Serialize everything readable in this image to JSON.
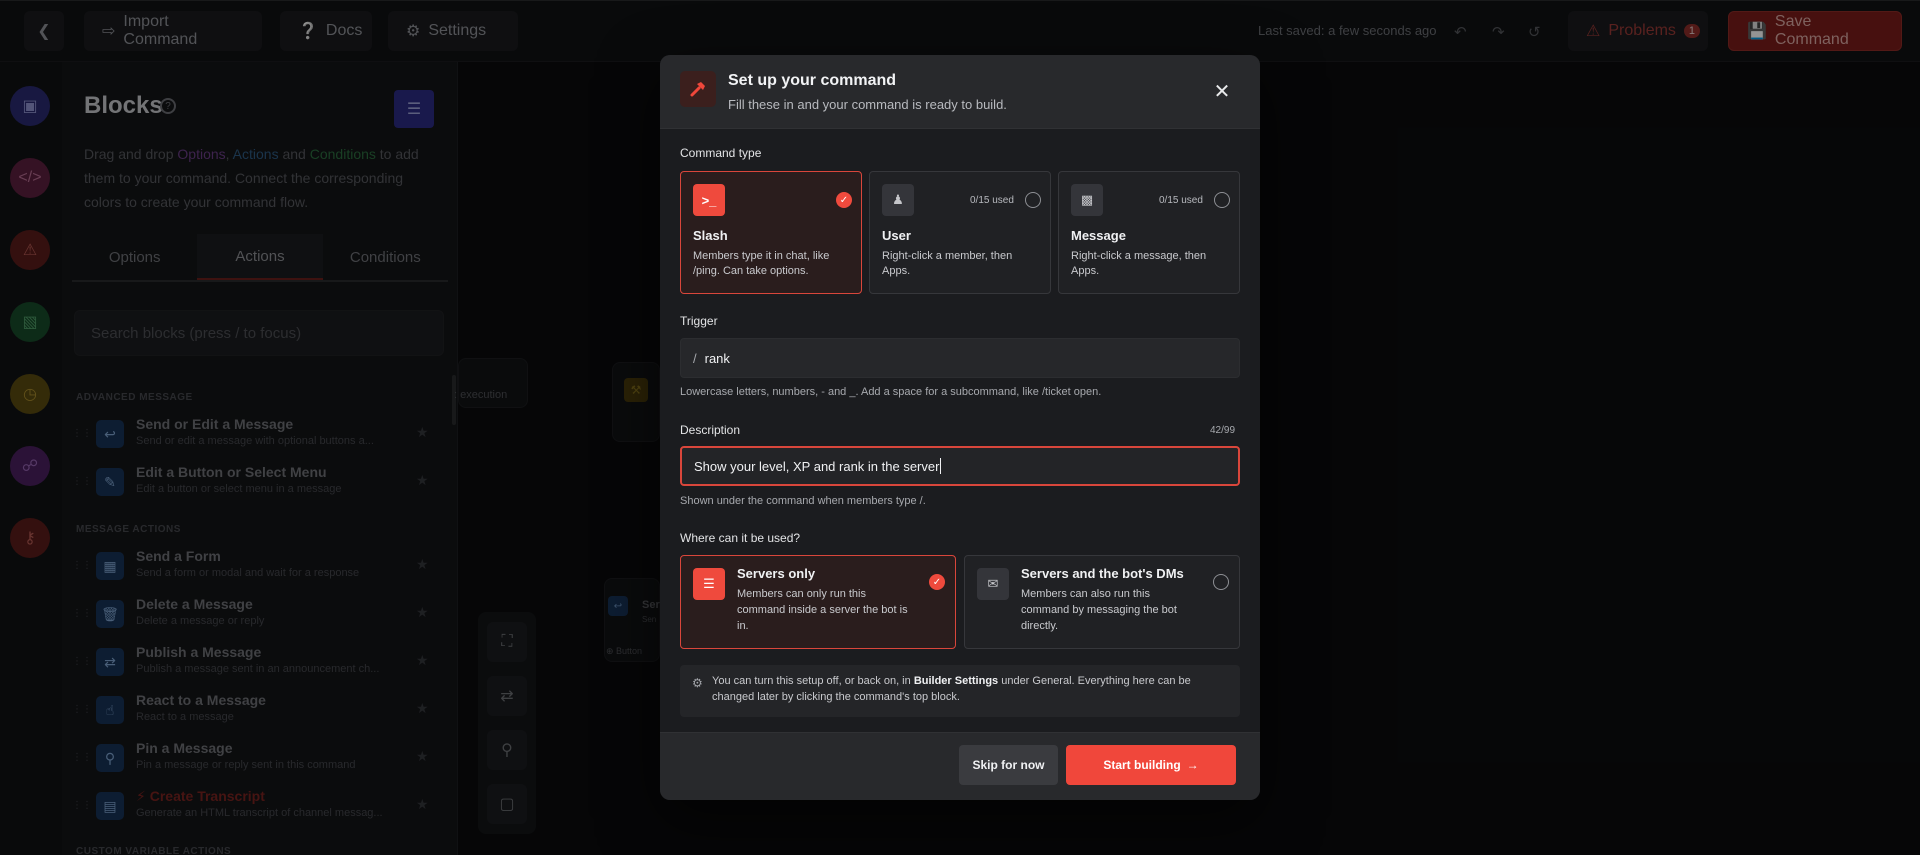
{
  "topbar": {
    "import_label": "Import Command",
    "docs_label": "Docs",
    "settings_label": "Settings",
    "last_saved": "Last saved: a few seconds ago",
    "problems_label": "Problems",
    "problems_count": "1",
    "save_label": "Save Command"
  },
  "panel": {
    "title": "Blocks",
    "desc_start": "Drag and drop ",
    "desc_options": "Options",
    "desc_sep1": ", ",
    "desc_actions": "Actions",
    "desc_sep2": " and ",
    "desc_conditions": "Conditions",
    "desc_end": " to add them to your command. Connect the corresponding colors to create your command flow.",
    "tabs": [
      "Options",
      "Actions",
      "Conditions"
    ],
    "search_placeholder": "Search blocks (press / to focus)",
    "sections": {
      "advanced": "ADVANCED MESSAGE",
      "message_actions": "MESSAGE ACTIONS",
      "custom_variable": "CUSTOM VARIABLE ACTIONS"
    },
    "blocks": [
      {
        "title": "Send or Edit a Message",
        "desc": "Send or edit a message with optional buttons a..."
      },
      {
        "title": "Edit a Button or Select Menu",
        "desc": "Edit a button or select menu in a message"
      },
      {
        "title": "Send a Form",
        "desc": "Send a form or modal and wait for a response"
      },
      {
        "title": "Delete a Message",
        "desc": "Delete a message or reply"
      },
      {
        "title": "Publish a Message",
        "desc": "Publish a message sent in an announcement ch..."
      },
      {
        "title": "React to a Message",
        "desc": "React to a message"
      },
      {
        "title": "Pin a Message",
        "desc": "Pin a message or reply sent in this command"
      },
      {
        "title": "Create Transcript",
        "desc": "Generate an HTML transcript of channel messag..."
      }
    ]
  },
  "canvas": {
    "frag_execution": ": execution",
    "frag_button": "Button",
    "frag_se": "Ser",
    "frag_sen": "Sen"
  },
  "modal": {
    "title": "Set up your command",
    "subtitle": "Fill these in and your command is ready to build.",
    "command_type_label": "Command type",
    "types": [
      {
        "name": "Slash",
        "desc": "Members type it in chat, like /ping. Can take options.",
        "used": "",
        "icon": "terminal-icon"
      },
      {
        "name": "User",
        "desc": "Right-click a member, then Apps.",
        "used": "0/15 used",
        "icon": "user-icon"
      },
      {
        "name": "Message",
        "desc": "Right-click a message, then Apps.",
        "used": "0/15 used",
        "icon": "message-icon"
      }
    ],
    "trigger_label": "Trigger",
    "trigger_prefix": "/",
    "trigger_value": "rank",
    "trigger_hint": "Lowercase letters, numbers, - and _. Add a space for a subcommand, like /ticket open.",
    "description_label": "Description",
    "description_count": "42/99",
    "description_value": "Show your level, XP and rank in the server",
    "description_hint": "Shown under the command when members type /.",
    "where_label": "Where can it be used?",
    "where": [
      {
        "name": "Servers only",
        "desc": "Members can only run this command inside a server the bot is in."
      },
      {
        "name": "Servers and the bot's DMs",
        "desc": "Members can also run this command by messaging the bot directly."
      }
    ],
    "note_start": "You can turn this setup off, or back on, in ",
    "note_bold": "Builder Settings",
    "note_end": " under General. Everything here can be changed later by clicking the command's top block.",
    "skip_label": "Skip for now",
    "start_label": "Start building",
    "accent_color": "#f0473b"
  }
}
